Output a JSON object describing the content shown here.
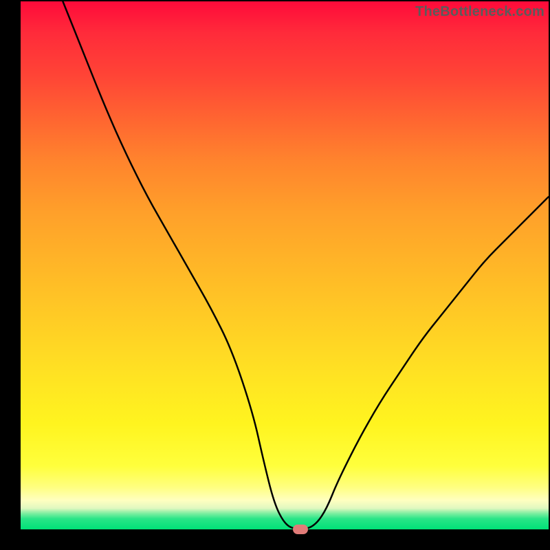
{
  "watermark": "TheBottleneck.com",
  "colors": {
    "frame": "#000000",
    "gradient_top": "#ff0a3a",
    "gradient_bottom": "#00e177",
    "curve": "#000000",
    "marker": "#e17b78",
    "watermark_text": "#5b5b5b"
  },
  "chart_data": {
    "type": "line",
    "title": "",
    "xlabel": "",
    "ylabel": "",
    "xlim": [
      0,
      100
    ],
    "ylim": [
      0,
      100
    ],
    "grid": false,
    "legend": false,
    "x": [
      8,
      12,
      16,
      20,
      24,
      28,
      32,
      36,
      40,
      44,
      46,
      48,
      50,
      52,
      54,
      56,
      58,
      60,
      64,
      68,
      72,
      76,
      80,
      84,
      88,
      92,
      96,
      100
    ],
    "values": [
      100,
      90,
      80,
      71,
      63,
      56,
      49,
      42,
      34,
      22,
      13,
      5,
      1,
      0,
      0,
      1,
      4,
      9,
      17,
      24,
      30,
      36,
      41,
      46,
      51,
      55,
      59,
      63
    ],
    "marker": {
      "x": 53,
      "y": 0
    },
    "notes": "V-shaped bottleneck curve. X axis is an unlabeled component-balance index (approx 0–100 left→right). Y axis is an unlabeled bottleneck percentage (0 at bottom, 100 at top). The curve reaches a minimum of ~0 around x≈52–55 where a small pink marker sits on the baseline. The background is a vertical heat gradient: red (high bottleneck) at the top through orange/yellow to green (no bottleneck) at the bottom."
  }
}
